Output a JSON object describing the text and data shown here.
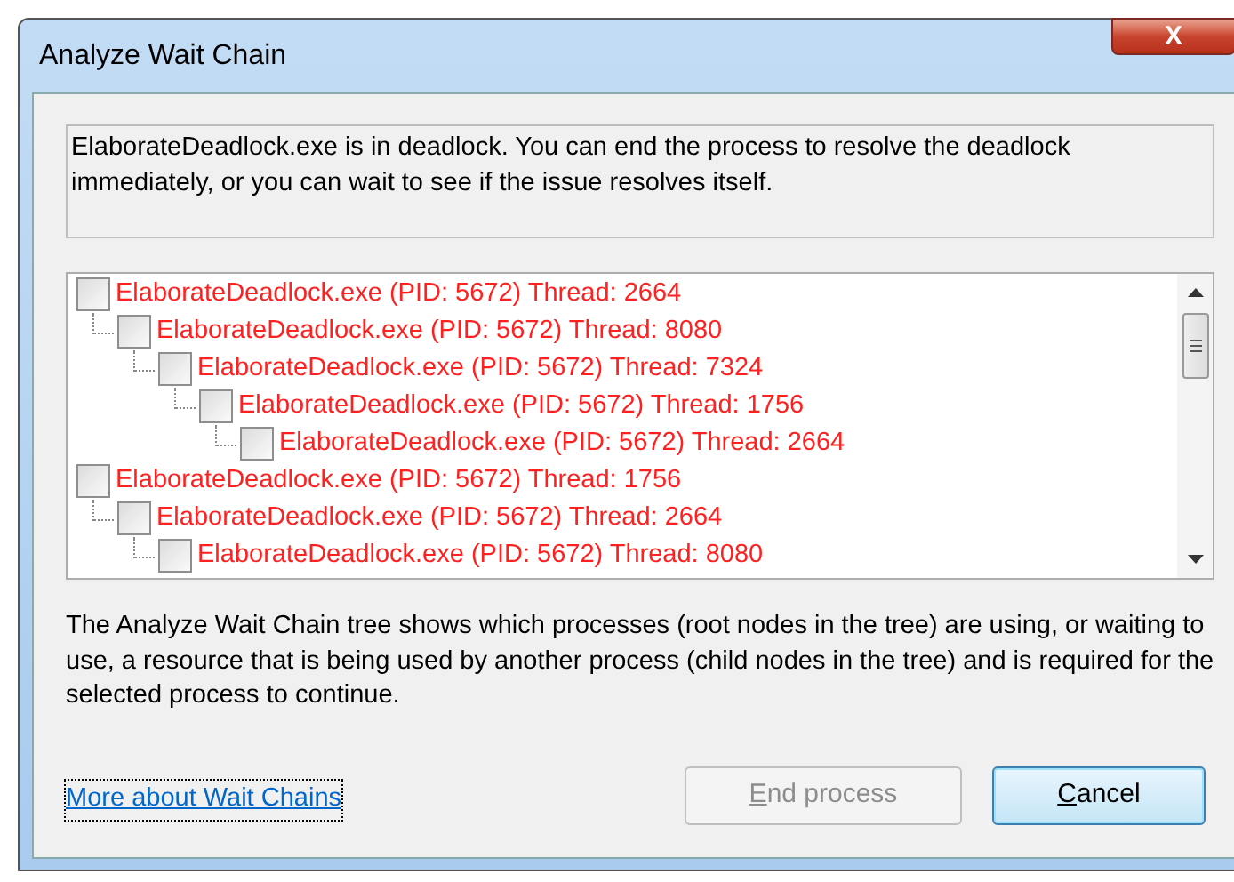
{
  "window": {
    "title": "Analyze Wait Chain",
    "close": "X"
  },
  "message": "ElaborateDeadlock.exe is in deadlock. You can end the process to resolve the deadlock immediately, or you can wait to see if the issue resolves itself.",
  "tree": [
    {
      "label": "ElaborateDeadlock.exe (PID: 5672) Thread: 2664",
      "checked": false,
      "children": [
        {
          "label": "ElaborateDeadlock.exe (PID: 5672) Thread: 8080",
          "checked": false,
          "children": [
            {
              "label": "ElaborateDeadlock.exe (PID: 5672) Thread: 7324",
              "checked": false,
              "children": [
                {
                  "label": "ElaborateDeadlock.exe (PID: 5672) Thread: 1756",
                  "checked": false,
                  "children": [
                    {
                      "label": "ElaborateDeadlock.exe (PID: 5672) Thread: 2664",
                      "checked": false
                    }
                  ]
                }
              ]
            }
          ]
        }
      ]
    },
    {
      "label": "ElaborateDeadlock.exe (PID: 5672) Thread: 1756",
      "checked": false,
      "children": [
        {
          "label": "ElaborateDeadlock.exe (PID: 5672) Thread: 2664",
          "checked": false,
          "children": [
            {
              "label": "ElaborateDeadlock.exe (PID: 5672) Thread: 8080",
              "checked": false
            }
          ]
        }
      ]
    }
  ],
  "description": "The Analyze Wait Chain tree shows which processes (root nodes in the tree) are using, or waiting to use, a resource that is being used by another process (child nodes in the tree) and is required for the selected process to continue.",
  "link": "More about Wait Chains",
  "buttons": [
    {
      "label": "End process",
      "disabled": true
    },
    {
      "label": "Cancel",
      "disabled": false
    }
  ]
}
